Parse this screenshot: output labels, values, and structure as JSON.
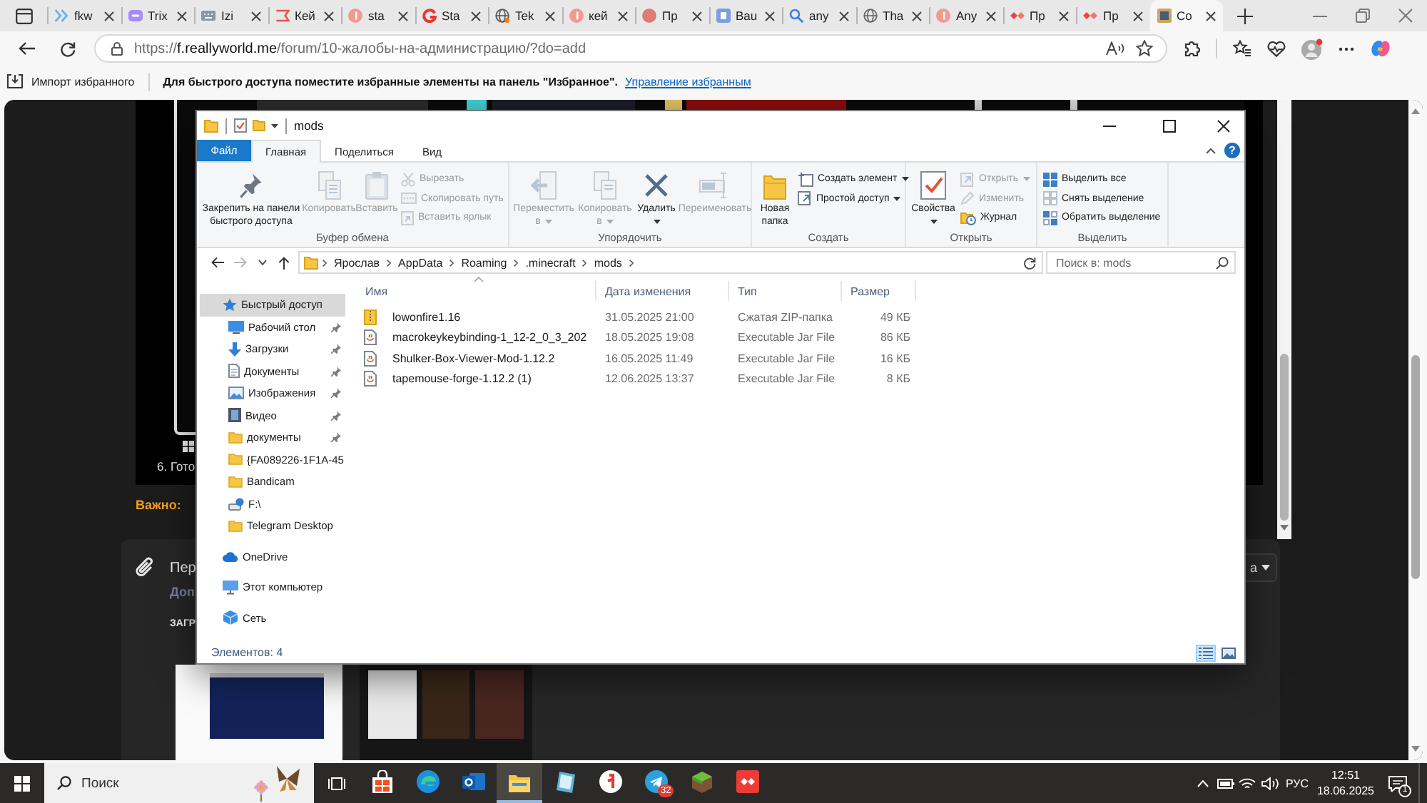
{
  "browser": {
    "tabs": [
      {
        "label": "fkw",
        "selected": false
      },
      {
        "label": "Trix",
        "selected": false
      },
      {
        "label": "Izi",
        "selected": false
      },
      {
        "label": "Кей",
        "selected": false
      },
      {
        "label": "sta",
        "selected": false
      },
      {
        "label": "Sta",
        "selected": false
      },
      {
        "label": "Tek",
        "selected": false
      },
      {
        "label": "кей",
        "selected": false
      },
      {
        "label": "Пр",
        "selected": false
      },
      {
        "label": "Bau",
        "selected": false
      },
      {
        "label": "any",
        "selected": false
      },
      {
        "label": "Tha",
        "selected": false
      },
      {
        "label": "Any",
        "selected": false
      },
      {
        "label": "Пр",
        "selected": false
      },
      {
        "label": "Пр",
        "selected": false
      },
      {
        "label": "Co",
        "selected": true
      }
    ],
    "address_bar": {
      "scheme": "https://",
      "host": "f.reallyworld.me",
      "path": "/forum/10-жалобы-на-администрацию/?do=add"
    },
    "favorites_bar": {
      "import_button": "Импорт избранного",
      "hint": "Для быстрого доступа поместите избранные элементы на панель \"Избранное\".",
      "manage_link": "Управление избранным"
    }
  },
  "web_page": {
    "step_text": "6. Гото",
    "important_label": "Важно:",
    "attachments": {
      "title": "Пер",
      "subtitle": "Доп",
      "uploads_label": "ЗАГР",
      "menu_button": "а"
    }
  },
  "explorer": {
    "title": "mods",
    "help": "?",
    "ribbon_tabs": [
      {
        "label": "Файл",
        "kind": "menu",
        "selected": false
      },
      {
        "label": "Главная",
        "kind": "tab",
        "selected": true
      },
      {
        "label": "Поделиться",
        "kind": "tab",
        "selected": false
      },
      {
        "label": "Вид",
        "kind": "tab",
        "selected": false
      }
    ],
    "ribbon_groups": [
      {
        "label": "Буфер обмена",
        "commands": [
          {
            "label": "Закрепить на панели быстрого доступа",
            "kind": "large",
            "disabled": false,
            "has_menu": false
          },
          {
            "label": "Копировать",
            "kind": "large",
            "disabled": true,
            "has_menu": false
          },
          {
            "label": "Вставить",
            "kind": "large",
            "disabled": true,
            "has_menu": false
          },
          {
            "label": "Вырезать",
            "kind": "small",
            "disabled": true,
            "has_menu": false
          },
          {
            "label": "Скопировать путь",
            "kind": "small",
            "disabled": true,
            "has_menu": false
          },
          {
            "label": "Вставить ярлык",
            "kind": "small",
            "disabled": true,
            "has_menu": false
          }
        ]
      },
      {
        "label": "Упорядочить",
        "commands": [
          {
            "label": "Переместить в",
            "kind": "large",
            "disabled": true,
            "has_menu": true
          },
          {
            "label": "Копировать в",
            "kind": "large",
            "disabled": true,
            "has_menu": true
          },
          {
            "label": "Удалить",
            "kind": "large",
            "disabled": false,
            "has_menu": true
          },
          {
            "label": "Переименовать",
            "kind": "large",
            "disabled": true,
            "has_menu": false
          }
        ]
      },
      {
        "label": "Создать",
        "commands": [
          {
            "label": "Новая папка",
            "kind": "large",
            "disabled": false,
            "has_menu": false
          },
          {
            "label": "Создать элемент",
            "kind": "small",
            "disabled": false,
            "has_menu": true
          },
          {
            "label": "Простой доступ",
            "kind": "small",
            "disabled": false,
            "has_menu": true
          }
        ]
      },
      {
        "label": "Открыть",
        "commands": [
          {
            "label": "Свойства",
            "kind": "large",
            "disabled": false,
            "has_menu": true
          },
          {
            "label": "Открыть",
            "kind": "small",
            "disabled": true,
            "has_menu": true
          },
          {
            "label": "Изменить",
            "kind": "small",
            "disabled": true,
            "has_menu": false
          },
          {
            "label": "Журнал",
            "kind": "small",
            "disabled": false,
            "has_menu": false
          }
        ]
      },
      {
        "label": "Выделить",
        "commands": [
          {
            "label": "Выделить все",
            "kind": "small",
            "disabled": false,
            "has_menu": false
          },
          {
            "label": "Снять выделение",
            "kind": "small",
            "disabled": false,
            "has_menu": false
          },
          {
            "label": "Обратить выделение",
            "kind": "small",
            "disabled": false,
            "has_menu": false
          }
        ]
      }
    ],
    "breadcrumb": [
      "Ярослав",
      "AppData",
      "Roaming",
      ".minecraft",
      "mods"
    ],
    "search": {
      "placeholder": "Поиск в: mods"
    },
    "navigation": [
      {
        "label": "Быстрый доступ",
        "selected": true,
        "children": [
          {
            "label": "Рабочий стол",
            "selected": false,
            "pinned": true
          },
          {
            "label": "Загрузки",
            "selected": false,
            "pinned": true
          },
          {
            "label": "Документы",
            "selected": false,
            "pinned": true
          },
          {
            "label": "Изображения",
            "selected": false,
            "pinned": true
          },
          {
            "label": "Видео",
            "selected": false,
            "pinned": true
          },
          {
            "label": "документы",
            "selected": false,
            "pinned": true
          },
          {
            "label": "{FA089226-1F1A-45",
            "selected": false,
            "pinned": false
          },
          {
            "label": "Bandicam",
            "selected": false,
            "pinned": false
          },
          {
            "label": "F:\\",
            "selected": false,
            "pinned": false
          },
          {
            "label": "Telegram Desktop",
            "selected": false,
            "pinned": false
          }
        ]
      },
      {
        "label": "OneDrive",
        "selected": false
      },
      {
        "label": "Этот компьютер",
        "selected": false
      },
      {
        "label": "Сеть",
        "selected": false
      }
    ],
    "columns": [
      {
        "label": "Имя",
        "sorted": true
      },
      {
        "label": "Дата изменения",
        "sorted": false
      },
      {
        "label": "Тип",
        "sorted": false
      },
      {
        "label": "Размер",
        "sorted": false
      }
    ],
    "files": [
      {
        "name": "lowonfire1.16",
        "kind": "zip",
        "modified": "31.05.2025 21:00",
        "type": "Сжатая ZIP-папка",
        "size": "49 КБ"
      },
      {
        "name": "macrokeykeybinding-1_12-2_0_3_202",
        "kind": "jar",
        "modified": "18.05.2025 19:08",
        "type": "Executable Jar File",
        "size": "86 КБ"
      },
      {
        "name": "Shulker-Box-Viewer-Mod-1.12.2",
        "kind": "jar",
        "modified": "16.05.2025 11:49",
        "type": "Executable Jar File",
        "size": "16 КБ"
      },
      {
        "name": "tapemouse-forge-1.12.2 (1)",
        "kind": "jar",
        "modified": "12.06.2025 13:37",
        "type": "Executable Jar File",
        "size": "8 КБ"
      }
    ],
    "status": "Элементов: 4",
    "views": [
      {
        "kind": "details",
        "selected": true
      },
      {
        "kind": "tiles",
        "selected": false
      }
    ]
  },
  "taskbar": {
    "search": {
      "placeholder": "Поиск"
    },
    "apps": [
      {
        "selected": false
      },
      {
        "selected": false
      },
      {
        "selected": false
      },
      {
        "selected": true
      },
      {
        "selected": false
      },
      {
        "selected": false
      },
      {
        "selected": false,
        "badge": "32"
      },
      {
        "selected": false
      },
      {
        "selected": false
      }
    ],
    "language": "РУС",
    "time": "12:51",
    "date": "18.06.2025",
    "notifications": "1"
  }
}
